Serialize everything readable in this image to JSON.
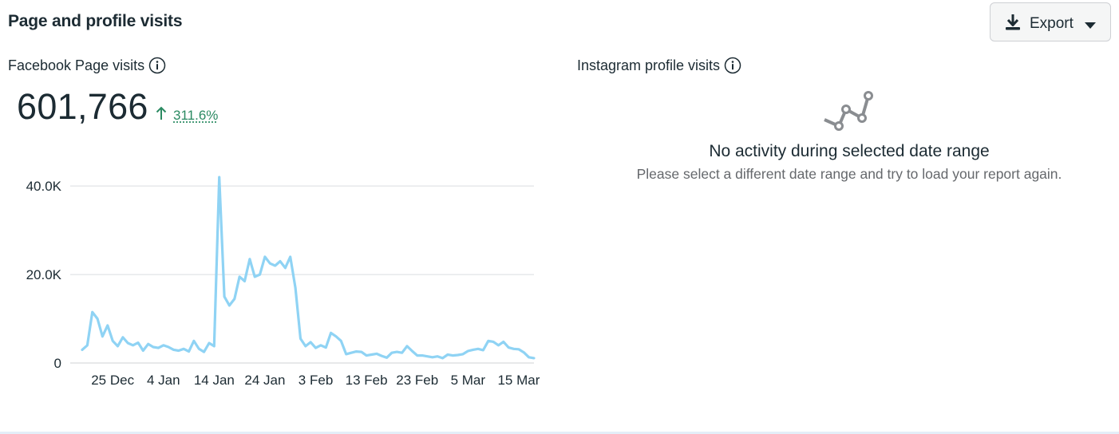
{
  "header": {
    "title": "Page and profile visits",
    "export_label": "Export"
  },
  "facebook": {
    "label": "Facebook Page visits",
    "total": "601,766",
    "change_pct": "311.6%",
    "change_direction": "up"
  },
  "instagram": {
    "label": "Instagram profile visits",
    "empty_title": "No activity during selected date range",
    "empty_message": "Please select a different date range and try to load your report again."
  },
  "colors": {
    "accent_line": "#8fd3f4",
    "positive": "#2b8a62",
    "text": "#1c2b33",
    "muted": "#65686c",
    "icon": "#8a8d91"
  },
  "icons": [
    "download-icon",
    "caret-down-icon",
    "info-icon",
    "arrow-up-icon",
    "line-chart-icon"
  ],
  "chart_data": {
    "type": "line",
    "series": [
      {
        "values": [
          3000,
          4000,
          11500,
          10000,
          6000,
          8500,
          5000,
          3800,
          5800,
          4500,
          4000,
          4600,
          2800,
          4300,
          3600,
          3400,
          4000,
          3600,
          3000,
          2800,
          3200,
          2600,
          5000,
          3200,
          2500,
          4500,
          3800,
          42000,
          15000,
          13000,
          14500,
          19500,
          18500,
          23500,
          19500,
          20000,
          24000,
          22500,
          22000,
          23000,
          21500,
          24000,
          17000,
          5500,
          3800,
          4700,
          3400,
          4000,
          3500,
          6800,
          6000,
          5000,
          2000,
          2300,
          2600,
          2500,
          1700,
          1900,
          2100,
          1600,
          1200,
          2300,
          2500,
          2300,
          3800,
          2700,
          1700,
          1700,
          1500,
          1300,
          1500,
          1100,
          1900,
          1700,
          1800,
          2000,
          2700,
          3000,
          3200,
          2900,
          5000,
          4800,
          4000,
          4800,
          3500,
          3200,
          3100,
          2400,
          1300,
          1100
        ]
      }
    ],
    "x_tick_labels": [
      "25 Dec",
      "4 Jan",
      "14 Jan",
      "24 Jan",
      "3 Feb",
      "13 Feb",
      "23 Feb",
      "5 Mar",
      "15 Mar"
    ],
    "x_tick_index": [
      6,
      16,
      26,
      36,
      46,
      56,
      66,
      76,
      86
    ],
    "y_tick_labels": [
      "0",
      "20.0K",
      "40.0K"
    ],
    "y_tick_values": [
      0,
      20000,
      40000
    ],
    "ylim": [
      0,
      44000
    ],
    "grid": true,
    "legend": "none"
  }
}
